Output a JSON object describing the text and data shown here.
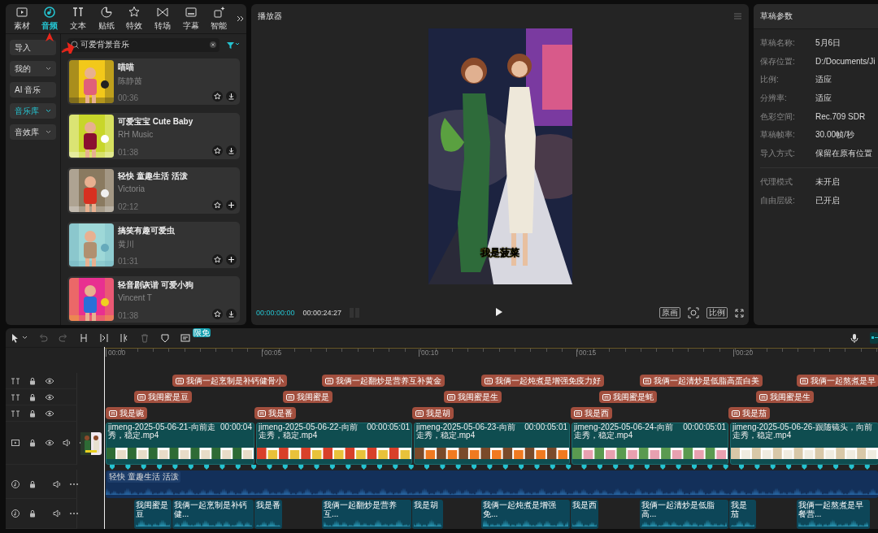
{
  "media_tabs": [
    {
      "label": "素材",
      "selected": false
    },
    {
      "label": "音频",
      "selected": true
    },
    {
      "label": "文本",
      "selected": false
    },
    {
      "label": "贴纸",
      "selected": false
    },
    {
      "label": "特效",
      "selected": false
    },
    {
      "label": "转场",
      "selected": false
    },
    {
      "label": "字幕",
      "selected": false
    },
    {
      "label": "智能",
      "selected": false
    }
  ],
  "audio_nav": [
    {
      "label": "导入",
      "selected": false,
      "dropdown": false
    },
    {
      "label": "我的",
      "selected": false,
      "dropdown": true
    },
    {
      "label": "AI 音乐",
      "selected": false,
      "dropdown": false
    },
    {
      "label": "音乐库",
      "selected": true,
      "dropdown": true
    },
    {
      "label": "音效库",
      "selected": false,
      "dropdown": true
    }
  ],
  "search": {
    "value": "可爱背景音乐"
  },
  "music_list": [
    {
      "title": "喵喵",
      "artist": "陈静茵",
      "duration": "00:36",
      "kind": "download"
    },
    {
      "title": "可爱宝宝  Cute Baby",
      "artist": "RH Music",
      "duration": "01:38",
      "kind": "download"
    },
    {
      "title": "轻快 童趣生活 活泼",
      "artist": "Victoria",
      "duration": "02:12",
      "kind": "add"
    },
    {
      "title": "搞笑有趣可爱虫",
      "artist": "黄川",
      "duration": "01:31",
      "kind": "add"
    },
    {
      "title": "轻音剧诙谐 可爱小狗",
      "artist": "Vincent T",
      "duration": "01:38",
      "kind": "download"
    }
  ],
  "player": {
    "title": "播放器",
    "caption": "我是菠菜",
    "current_time": "00:00:00:00",
    "total_time": "00:00:24:27",
    "buttons": [
      "原画",
      "比例"
    ]
  },
  "draft": {
    "title": "草稿参数",
    "groups": [
      [
        {
          "label": "草稿名称:",
          "value": "5月6日"
        },
        {
          "label": "保存位置:",
          "value": "D:/Documents/Ji"
        },
        {
          "label": "比例:",
          "value": "适应"
        },
        {
          "label": "分辨率:",
          "value": "适应"
        },
        {
          "label": "色彩空间:",
          "value": "Rec.709 SDR"
        },
        {
          "label": "草稿帧率:",
          "value": "30.00帧/秒"
        },
        {
          "label": "导入方式:",
          "value": "保留在原有位置"
        }
      ],
      [
        {
          "label": "代理模式",
          "value": "未开启"
        },
        {
          "label": "自由层级:",
          "value": "已开启"
        }
      ]
    ]
  },
  "timeline": {
    "badge": "限免",
    "ruler": [
      "00:00",
      "00:05",
      "00:10",
      "00:15",
      "00:20"
    ],
    "text_tracks": [
      [
        "我俩一起烹制是补钙健骨小",
        "我俩一起翻炒是营养互补黄金",
        "我俩一起炖煮是增强免疫力好",
        "我俩一起清炒是低脂高蛋白美",
        "我俩一起熬煮是早"
      ],
      [
        "我闺蜜是豆",
        "我闺蜜是",
        "我闺蜜是生",
        "我闺蜜是蚝",
        "我闺蜜是生"
      ],
      [
        "我是豌",
        "我是番",
        "我是胡",
        "我是西",
        "我是茄"
      ]
    ],
    "video_clips": [
      {
        "name": "jimeng-2025-05-06-21-向前走秀，稳定.mp4",
        "duration": "00:00:04"
      },
      {
        "name": "jimeng-2025-05-06-22-向前走秀，稳定.mp4",
        "duration": "00:00:05:01"
      },
      {
        "name": "jimeng-2025-05-06-23-向前走秀，稳定.mp4",
        "duration": "00:00:05:01"
      },
      {
        "name": "jimeng-2025-05-06-24-向前走秀，稳定.mp4",
        "duration": "00:00:05:01"
      },
      {
        "name": "jimeng-2025-05-06-26-跟随镜头，向前走秀，稳定.mp4"
      }
    ],
    "music_clip": "轻快 童趣生活 活泼",
    "voice_clips": [
      "我闺蜜是豆",
      "我俩一起烹制是补钙健...",
      "我是番",
      "我俩一起翻炒是营养互...",
      "我是胡",
      "我俩一起炖煮是增强免...",
      "我是西",
      "我俩一起清炒是低脂高...",
      "我是茄",
      "我俩一起熬煮是早餐营..."
    ]
  }
}
